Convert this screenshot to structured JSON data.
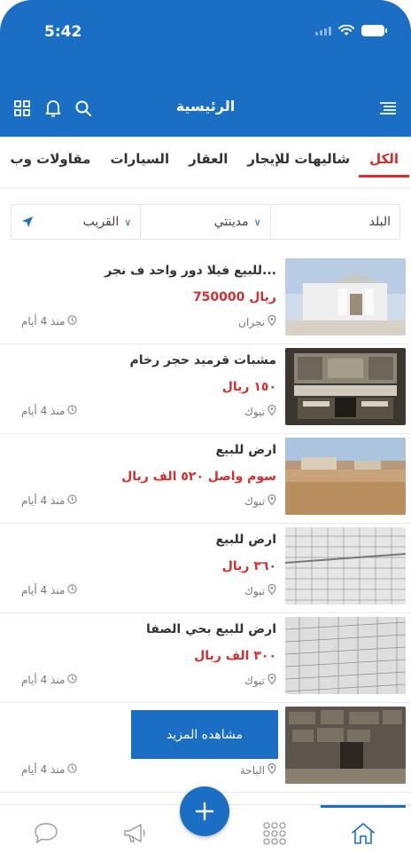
{
  "status_bar": {
    "time": "5:42"
  },
  "header": {
    "title": "الرئيسية"
  },
  "tabs": [
    {
      "label": "الكل",
      "active": true
    },
    {
      "label": "شاليهات للإيجار",
      "active": false
    },
    {
      "label": "العقار",
      "active": false
    },
    {
      "label": "السيارات",
      "active": false
    },
    {
      "label": "مقاولات وب",
      "active": false
    }
  ],
  "filters": {
    "country": "البلد",
    "city": "مدينتي",
    "nearby": "القريب"
  },
  "listings": [
    {
      "title": "للبيع فيلا دور واحد ف نجر...",
      "price": "750000 ريال",
      "location": "نجران",
      "time": "منذ 4 أيام",
      "image": "villa"
    },
    {
      "title": "مشبات قرميد حجر رخام",
      "price": "١٥٠ ريال",
      "location": "تبوك",
      "time": "منذ 4 أيام",
      "image": "fireplace"
    },
    {
      "title": "ارض للبيع",
      "price": "سوم واصل ٥٢٠ الف ريال",
      "location": "تبوك",
      "time": "منذ 4 أيام",
      "image": "land"
    },
    {
      "title": "ارض للبيع",
      "price": "٣٦٠ ريال",
      "location": "تبوك",
      "time": "منذ 4 أيام",
      "image": "plan"
    },
    {
      "title": "ارض للبيع بحي الصفا",
      "price": "٣٠٠ الف ريال",
      "location": "تبوك",
      "time": "منذ 4 أيام",
      "image": "plan"
    },
    {
      "title": "",
      "price": "",
      "location": "الباحة",
      "time": "منذ 4 أيام",
      "image": "stone"
    }
  ],
  "more_button": "مشاهده المزيد",
  "colors": {
    "primary": "#1a6fc4",
    "accent": "#d32f2f"
  },
  "icons": {
    "menu": "menu-icon",
    "search": "search-icon",
    "bell": "bell-icon",
    "grid": "grid-icon",
    "home": "home-icon",
    "apps": "apps-icon",
    "megaphone": "megaphone-icon",
    "chat": "chat-icon",
    "add": "plus-icon"
  }
}
